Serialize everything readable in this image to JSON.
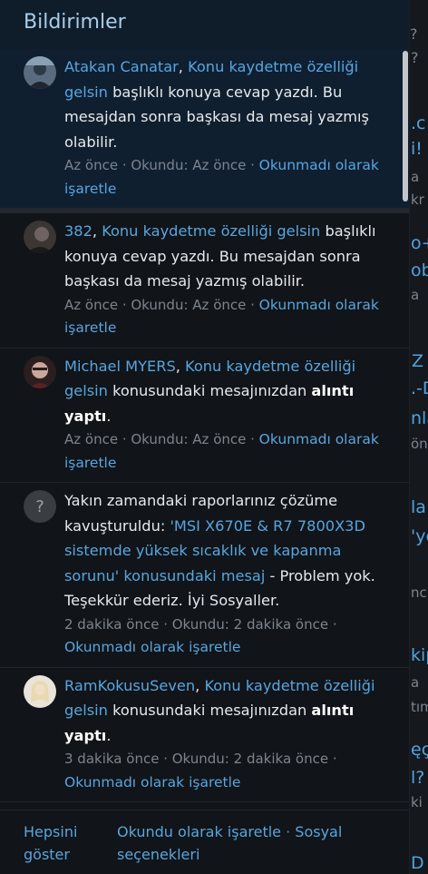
{
  "panel": {
    "title": "Bildirimler"
  },
  "notifications": [
    {
      "user": "Atakan Canatar",
      "sep": ", ",
      "thread": "Konu kaydetme özelliği gelsin",
      "text": " başlıklı konuya cevap yazdı. Bu mesajdan sonra başkası da mesaj yazmış olabilir.",
      "time": "Az önce",
      "read_label": "Okundu:",
      "read_time": "Az önce",
      "action": "Okunmadı olarak işaretle",
      "unread": true
    },
    {
      "user": "382",
      "sep": ", ",
      "thread": "Konu kaydetme özelliği gelsin",
      "text": " başlıklı konuya cevap yazdı. Bu mesajdan sonra başkası da mesaj yazmış olabilir.",
      "time": "Az önce",
      "read_label": "Okundu:",
      "read_time": "Az önce",
      "action": "Okunmadı olarak işaretle"
    },
    {
      "user": "Michael MYERS",
      "sep": ", ",
      "thread": "Konu kaydetme özelliği gelsin",
      "text": " konusundaki mesajınızdan ",
      "bold": "alıntı yaptı",
      "end": ".",
      "time": "Az önce",
      "read_label": "Okundu:",
      "read_time": "Az önce",
      "action": "Okunmadı olarak işaretle"
    },
    {
      "avatar_glyph": "?",
      "prefix": "Yakın zamandaki raporlarınız çözüme kavuşturuldu: ",
      "link": "'MSI X670E & R7 7800X3D sistemde yüksek sıcaklık ve kapanma sorunu' konusundaki mesaj",
      "suffix": " - Problem yok. Teşekkür ederiz. İyi Sosyaller.",
      "time": "2 dakika önce",
      "read_label": "Okundu:",
      "read_time": "2 dakika önce",
      "action": "Okunmadı olarak işaretle"
    },
    {
      "user": "RamKokusuSeven",
      "sep": ", ",
      "thread": "Konu kaydetme özelliği gelsin",
      "text": " konusundaki mesajınızdan ",
      "bold": "alıntı yaptı",
      "end": ".",
      "time": "3 dakika önce",
      "read_label": "Okundu:",
      "read_time": "2 dakika önce",
      "action": "Okunmadı olarak işaretle"
    }
  ],
  "footer": {
    "show_all": "Hepsini göster",
    "mark_read": "Okundu olarak işaretle",
    "separator": " · ",
    "preferences": "Sosyal seçenekleri"
  },
  "colors": {
    "header_bg": "#0f1d2b",
    "unread_bg": "#0f1f30",
    "link": "#57a6e0",
    "muted": "#7c848e"
  }
}
